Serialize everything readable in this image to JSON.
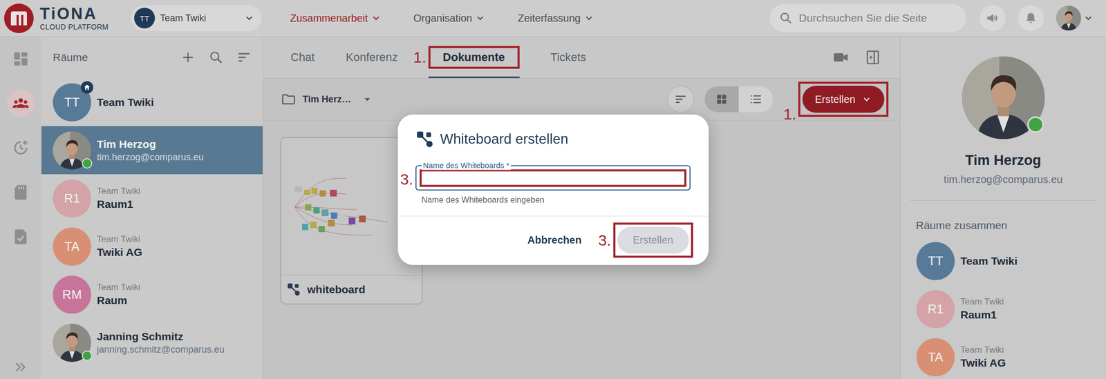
{
  "app": {
    "logo": "TiONA",
    "subtitle": "CLOUD PLATFORM"
  },
  "team_selector": {
    "initials": "TT",
    "label": "Team Twiki",
    "color": "#1f3a56"
  },
  "menu": [
    {
      "label": "Zusammenarbeit",
      "selected": true
    },
    {
      "label": "Organisation",
      "selected": false
    },
    {
      "label": "Zeiterfassung",
      "selected": false
    }
  ],
  "search": {
    "placeholder": "Durchsuchen Sie die Seite"
  },
  "rail": [
    {
      "selected": false
    },
    {
      "selected": true
    },
    {
      "selected": false
    },
    {
      "selected": false
    },
    {
      "selected": false
    }
  ],
  "rooms": {
    "title": "Räume",
    "items": [
      {
        "kind": "team",
        "initials": "TT",
        "color": "#587a99",
        "name": "Team Twiki",
        "home": true,
        "selected": false
      },
      {
        "kind": "person",
        "name": "Tim Herzog",
        "email": "tim.herzog@comparus.eu",
        "online": true,
        "selected": true
      },
      {
        "kind": "room",
        "initials": "R1",
        "color": "#d4a3a7",
        "group": "Team Twiki",
        "name": "Raum1",
        "selected": false
      },
      {
        "kind": "room",
        "initials": "TA",
        "color": "#d88f74",
        "group": "Team Twiki",
        "name": "Twiki AG",
        "selected": false
      },
      {
        "kind": "room",
        "initials": "RM",
        "color": "#c8749a",
        "group": "Team Twiki",
        "name": "Raum",
        "selected": false
      },
      {
        "kind": "person",
        "name": "Janning Schmitz",
        "email": "janning.schmitz@comparus.eu",
        "online": true,
        "selected": false
      }
    ]
  },
  "tabs": [
    {
      "label": "Chat",
      "selected": false,
      "step": null
    },
    {
      "label": "Konferenz",
      "selected": false,
      "step": null
    },
    {
      "label": "Dokumente",
      "selected": true,
      "step": "1."
    },
    {
      "label": "Tickets",
      "selected": false,
      "step": null
    }
  ],
  "folder": {
    "label": "Tim Herz…"
  },
  "view_modes": [
    {
      "selected": true
    },
    {
      "selected": false
    }
  ],
  "create_button": {
    "label": "Erstellen",
    "step": "1."
  },
  "documents": [
    {
      "name": "whiteboard"
    }
  ],
  "dialog": {
    "title": "Whiteboard erstellen",
    "field": {
      "label": "Name des Whiteboards *",
      "value": "",
      "helper": "Name des Whiteboards eingeben",
      "step": "3."
    },
    "buttons": [
      {
        "label": "Abbrechen",
        "disabled": false,
        "step": null
      },
      {
        "label": "Erstellen",
        "disabled": true,
        "step": "3."
      }
    ]
  },
  "profile": {
    "name": "Tim Herzog",
    "email": "tim.herzog@comparus.eu",
    "online": true,
    "shared_title": "Räume zusammen",
    "shared_rooms": [
      {
        "initials": "TT",
        "color": "#587a99",
        "group": null,
        "name": "Team Twiki"
      },
      {
        "initials": "R1",
        "color": "#d4a3a7",
        "group": "Team Twiki",
        "name": "Raum1"
      },
      {
        "initials": "TA",
        "color": "#d88f74",
        "group": "Team Twiki",
        "name": "Twiki AG"
      }
    ]
  }
}
